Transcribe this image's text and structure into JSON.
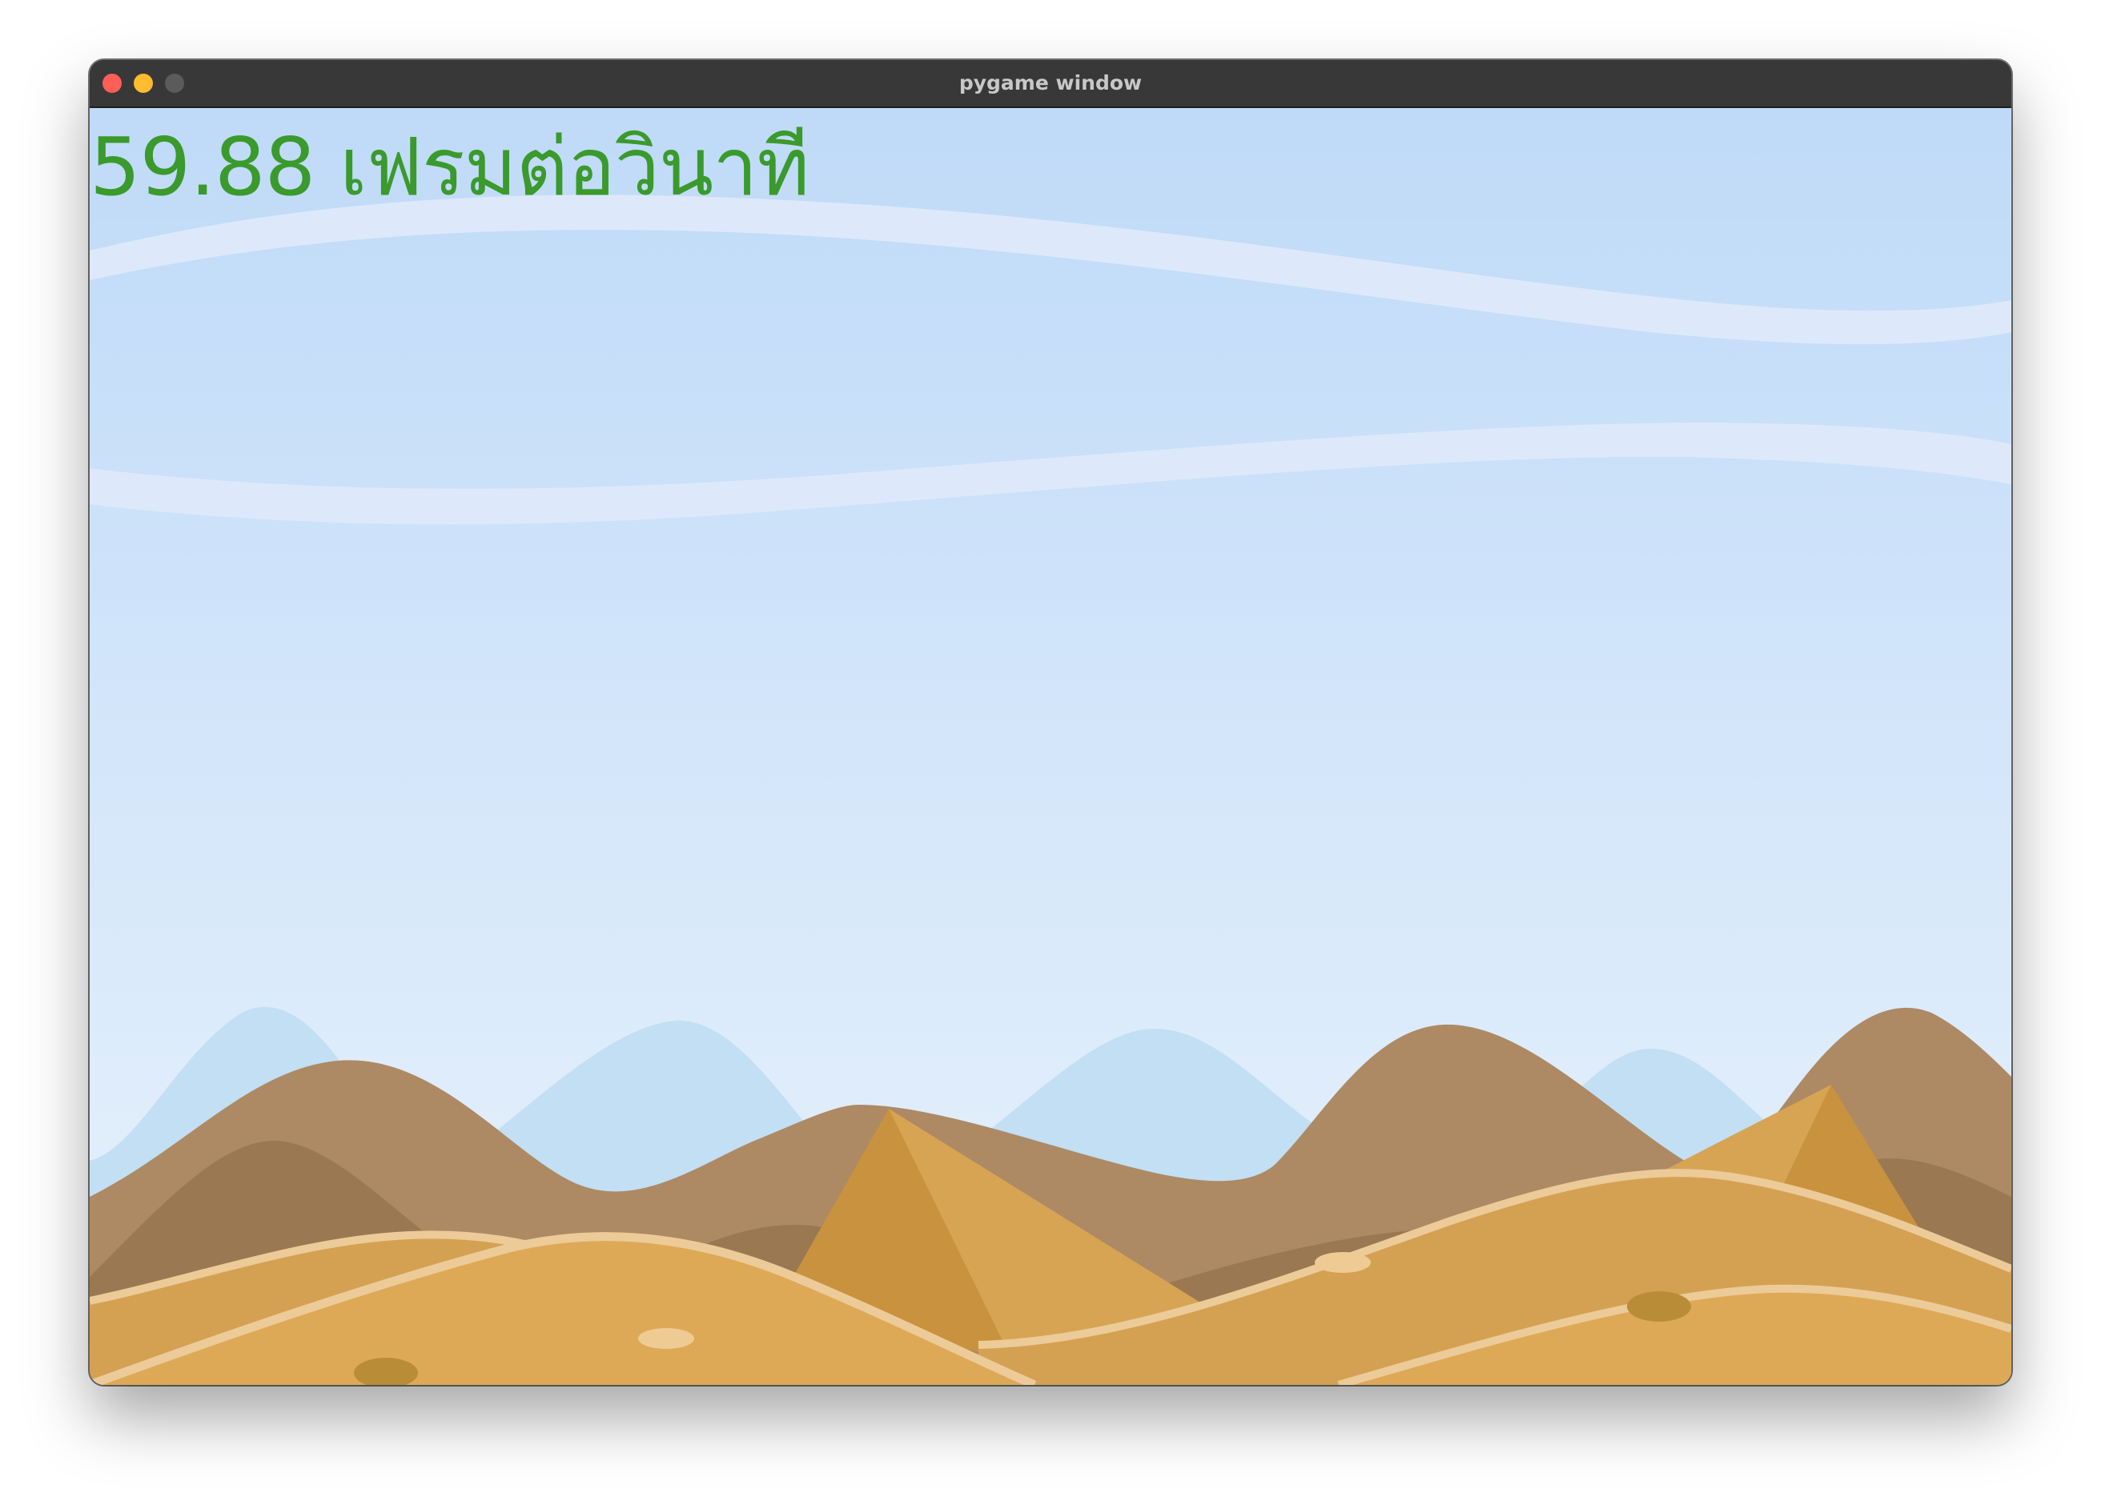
{
  "window": {
    "title": "pygame window",
    "controls": {
      "close_color": "#ff5f57",
      "minimize_color": "#febc2e",
      "zoom_color": "#5b5b5b"
    }
  },
  "hud": {
    "fps_text": "59.88 เฟรมต่อวินาที",
    "fps_color": "#3a9a2c"
  },
  "scene": {
    "sky_top_color": "#bfdaf8",
    "sky_bottom_color": "#e8f2fc",
    "cloud_band_color": "#dde9fb",
    "far_hill_color": "#c2dff4",
    "mountain_color": "#ad8a64",
    "mountain_shadow_color": "#9a7852",
    "pyramid_light_color": "#d6a453",
    "pyramid_dark_color": "#c9923e",
    "dune_color": "#dea956",
    "dune_back_color": "#d4a152",
    "dune_ridge_color": "#eccb98",
    "stone_light_color": "#efcb94",
    "stone_dark_color": "#b98c38"
  }
}
